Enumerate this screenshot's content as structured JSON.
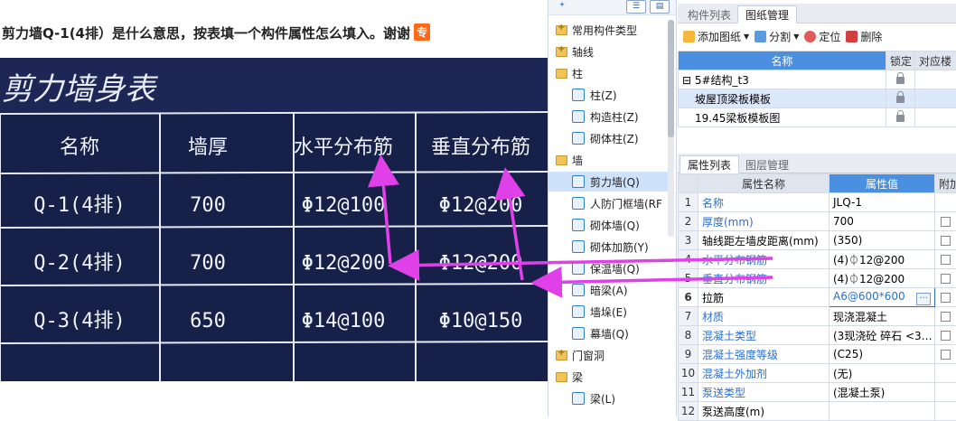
{
  "question": {
    "title": "剪力墙Q-1(4排）是什么意思，按表填一个构件属性怎么填入。谢谢",
    "badge": "专"
  },
  "photo": {
    "heading": "剪力墙身表",
    "headers": [
      "名称",
      "墙厚",
      "水平分布筋",
      "垂直分布筋"
    ],
    "rows": [
      [
        "Q-1(4排)",
        "700",
        "Φ12@100",
        "Φ12@200"
      ],
      [
        "Q-2(4排)",
        "700",
        "Φ12@200",
        "Φ12@200"
      ],
      [
        "Q-3(4排)",
        "650",
        "Φ14@100",
        "Φ10@150"
      ]
    ]
  },
  "tree": {
    "items": [
      {
        "label": "常用构件类型",
        "kind": "folder"
      },
      {
        "label": "轴线",
        "kind": "folder"
      },
      {
        "label": "柱",
        "kind": "folder"
      },
      {
        "label": "柱(Z)",
        "kind": "item"
      },
      {
        "label": "构造柱(Z)",
        "kind": "item"
      },
      {
        "label": "砌体柱(Z)",
        "kind": "item"
      },
      {
        "label": "墙",
        "kind": "folder"
      },
      {
        "label": "剪力墙(Q)",
        "kind": "item",
        "selected": true
      },
      {
        "label": "人防门框墙(RF",
        "kind": "item"
      },
      {
        "label": "砌体墙(Q)",
        "kind": "item"
      },
      {
        "label": "砌体加筋(Y)",
        "kind": "item"
      },
      {
        "label": "保温墙(Q)",
        "kind": "item"
      },
      {
        "label": "暗梁(A)",
        "kind": "item"
      },
      {
        "label": "墙垛(E)",
        "kind": "item"
      },
      {
        "label": "幕墙(Q)",
        "kind": "item"
      },
      {
        "label": "门窗洞",
        "kind": "folder"
      },
      {
        "label": "梁",
        "kind": "folder"
      },
      {
        "label": "梁(L)",
        "kind": "item"
      }
    ]
  },
  "drawings": {
    "tabs": [
      "构件列表",
      "图纸管理"
    ],
    "toolbar": [
      "添加图纸",
      "分割",
      "定位",
      "删除"
    ],
    "columns": [
      "名称",
      "锁定",
      "对应楼"
    ],
    "rows": [
      {
        "name": "5#结构_t3",
        "prefix": "−"
      },
      {
        "name": "坡屋顶梁板模板",
        "prefix": ""
      },
      {
        "name": "19.45梁板模板图",
        "prefix": ""
      }
    ]
  },
  "props": {
    "tabs": [
      "属性列表",
      "图层管理"
    ],
    "columns": [
      "属性名称",
      "属性值",
      "附加"
    ],
    "rows": [
      {
        "n": "1",
        "name": "名称",
        "value": "JLQ-1",
        "link": true
      },
      {
        "n": "2",
        "name": "厚度(mm)",
        "value": "700",
        "link": true,
        "check": true
      },
      {
        "n": "3",
        "name": "轴线距左墙皮距离(mm)",
        "value": "(350)",
        "link": false,
        "check": true
      },
      {
        "n": "4",
        "name": "水平分布钢筋",
        "value": "(4)⏀12@200",
        "link": true,
        "check": true
      },
      {
        "n": "5",
        "name": "垂直分布钢筋",
        "value": "(4)⏀12@200",
        "link": true,
        "check": true
      },
      {
        "n": "6",
        "name": "拉筋",
        "value": "A6@600*600",
        "link": false,
        "editing": true,
        "check": true
      },
      {
        "n": "7",
        "name": "材质",
        "value": "现浇混凝土",
        "link": true,
        "check": true
      },
      {
        "n": "8",
        "name": "混凝土类型",
        "value": "(3现浇砼 碎石 <3…",
        "link": true,
        "check": true
      },
      {
        "n": "9",
        "name": "混凝土强度等级",
        "value": "(C25)",
        "link": true,
        "check": true
      },
      {
        "n": "10",
        "name": "混凝土外加剂",
        "value": "(无)",
        "link": true
      },
      {
        "n": "11",
        "name": "泵送类型",
        "value": "(混凝土泵)",
        "link": true
      },
      {
        "n": "12",
        "name": "泵送高度(m)",
        "value": "",
        "link": false
      }
    ]
  },
  "colors": {
    "accent": "#4a8fe0",
    "arrow": "#e040e8",
    "link": "#2a6fd0"
  }
}
